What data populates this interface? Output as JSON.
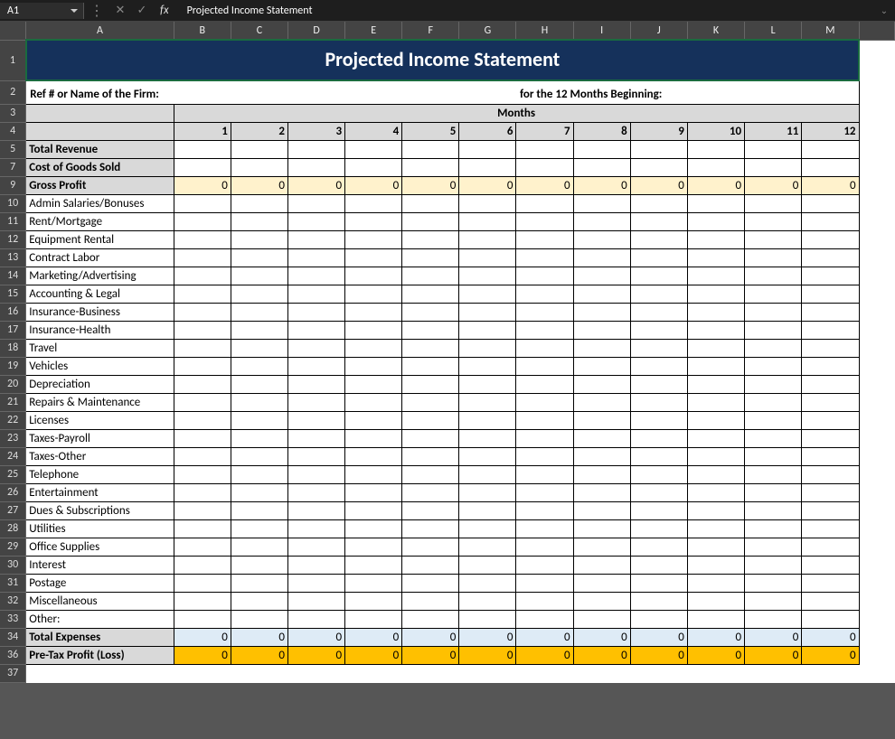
{
  "formulaBar": {
    "cellRef": "A1",
    "formulaValue": "Projected Income Statement"
  },
  "columns": [
    "A",
    "B",
    "C",
    "D",
    "E",
    "F",
    "G",
    "H",
    "I",
    "J",
    "K",
    "L",
    "M"
  ],
  "title": "Projected Income Statement",
  "refLabel": "Ref # or Name of the Firm:",
  "periodLabel": "for the 12 Months Beginning:",
  "monthsHeader": "Months",
  "monthNumbers": [
    "1",
    "2",
    "3",
    "4",
    "5",
    "6",
    "7",
    "8",
    "9",
    "10",
    "11",
    "12"
  ],
  "rows": [
    {
      "num": "5",
      "label": "Total Revenue",
      "style": "bold-label",
      "vals": [
        "",
        "",
        "",
        "",
        "",
        "",
        "",
        "",
        "",
        "",
        "",
        ""
      ]
    },
    {
      "num": "7",
      "label": "Cost of Goods Sold",
      "style": "bold-label",
      "vals": [
        "",
        "",
        "",
        "",
        "",
        "",
        "",
        "",
        "",
        "",
        "",
        ""
      ]
    },
    {
      "num": "9",
      "label": "Gross Profit",
      "style": "calc-gross",
      "vals": [
        "0",
        "0",
        "0",
        "0",
        "0",
        "0",
        "0",
        "0",
        "0",
        "0",
        "0",
        "0"
      ]
    },
    {
      "num": "10",
      "label": "Admin Salaries/Bonuses",
      "style": "plain-label",
      "vals": [
        "",
        "",
        "",
        "",
        "",
        "",
        "",
        "",
        "",
        "",
        "",
        ""
      ]
    },
    {
      "num": "11",
      "label": "Rent/Mortgage",
      "style": "plain-label",
      "vals": [
        "",
        "",
        "",
        "",
        "",
        "",
        "",
        "",
        "",
        "",
        "",
        ""
      ]
    },
    {
      "num": "12",
      "label": "Equipment Rental",
      "style": "plain-label",
      "vals": [
        "",
        "",
        "",
        "",
        "",
        "",
        "",
        "",
        "",
        "",
        "",
        ""
      ]
    },
    {
      "num": "13",
      "label": "Contract Labor",
      "style": "plain-label",
      "vals": [
        "",
        "",
        "",
        "",
        "",
        "",
        "",
        "",
        "",
        "",
        "",
        ""
      ]
    },
    {
      "num": "14",
      "label": "Marketing/Advertising",
      "style": "plain-label",
      "vals": [
        "",
        "",
        "",
        "",
        "",
        "",
        "",
        "",
        "",
        "",
        "",
        ""
      ]
    },
    {
      "num": "15",
      "label": "Accounting & Legal",
      "style": "plain-label",
      "vals": [
        "",
        "",
        "",
        "",
        "",
        "",
        "",
        "",
        "",
        "",
        "",
        ""
      ]
    },
    {
      "num": "16",
      "label": "Insurance-Business",
      "style": "plain-label",
      "vals": [
        "",
        "",
        "",
        "",
        "",
        "",
        "",
        "",
        "",
        "",
        "",
        ""
      ]
    },
    {
      "num": "17",
      "label": "Insurance-Health",
      "style": "plain-label",
      "vals": [
        "",
        "",
        "",
        "",
        "",
        "",
        "",
        "",
        "",
        "",
        "",
        ""
      ]
    },
    {
      "num": "18",
      "label": "Travel",
      "style": "plain-label",
      "vals": [
        "",
        "",
        "",
        "",
        "",
        "",
        "",
        "",
        "",
        "",
        "",
        ""
      ]
    },
    {
      "num": "19",
      "label": "Vehicles",
      "style": "plain-label",
      "vals": [
        "",
        "",
        "",
        "",
        "",
        "",
        "",
        "",
        "",
        "",
        "",
        ""
      ]
    },
    {
      "num": "20",
      "label": "Depreciation",
      "style": "plain-label",
      "vals": [
        "",
        "",
        "",
        "",
        "",
        "",
        "",
        "",
        "",
        "",
        "",
        ""
      ]
    },
    {
      "num": "21",
      "label": "Repairs & Maintenance",
      "style": "plain-label",
      "vals": [
        "",
        "",
        "",
        "",
        "",
        "",
        "",
        "",
        "",
        "",
        "",
        ""
      ]
    },
    {
      "num": "22",
      "label": "Licenses",
      "style": "plain-label",
      "vals": [
        "",
        "",
        "",
        "",
        "",
        "",
        "",
        "",
        "",
        "",
        "",
        ""
      ]
    },
    {
      "num": "23",
      "label": "Taxes-Payroll",
      "style": "plain-label",
      "vals": [
        "",
        "",
        "",
        "",
        "",
        "",
        "",
        "",
        "",
        "",
        "",
        ""
      ]
    },
    {
      "num": "24",
      "label": "Taxes-Other",
      "style": "plain-label",
      "vals": [
        "",
        "",
        "",
        "",
        "",
        "",
        "",
        "",
        "",
        "",
        "",
        ""
      ]
    },
    {
      "num": "25",
      "label": "Telephone",
      "style": "plain-label",
      "vals": [
        "",
        "",
        "",
        "",
        "",
        "",
        "",
        "",
        "",
        "",
        "",
        ""
      ]
    },
    {
      "num": "26",
      "label": "Entertainment",
      "style": "plain-label",
      "vals": [
        "",
        "",
        "",
        "",
        "",
        "",
        "",
        "",
        "",
        "",
        "",
        ""
      ]
    },
    {
      "num": "27",
      "label": "Dues & Subscriptions",
      "style": "plain-label",
      "vals": [
        "",
        "",
        "",
        "",
        "",
        "",
        "",
        "",
        "",
        "",
        "",
        ""
      ]
    },
    {
      "num": "28",
      "label": "Utilities",
      "style": "plain-label",
      "vals": [
        "",
        "",
        "",
        "",
        "",
        "",
        "",
        "",
        "",
        "",
        "",
        ""
      ]
    },
    {
      "num": "29",
      "label": "Office Supplies",
      "style": "plain-label",
      "vals": [
        "",
        "",
        "",
        "",
        "",
        "",
        "",
        "",
        "",
        "",
        "",
        ""
      ]
    },
    {
      "num": "30",
      "label": "Interest",
      "style": "plain-label",
      "vals": [
        "",
        "",
        "",
        "",
        "",
        "",
        "",
        "",
        "",
        "",
        "",
        ""
      ]
    },
    {
      "num": "31",
      "label": "Postage",
      "style": "plain-label",
      "vals": [
        "",
        "",
        "",
        "",
        "",
        "",
        "",
        "",
        "",
        "",
        "",
        ""
      ]
    },
    {
      "num": "32",
      "label": "Miscellaneous",
      "style": "plain-label",
      "vals": [
        "",
        "",
        "",
        "",
        "",
        "",
        "",
        "",
        "",
        "",
        "",
        ""
      ]
    },
    {
      "num": "33",
      "label": "Other:",
      "style": "plain-label",
      "vals": [
        "",
        "",
        "",
        "",
        "",
        "",
        "",
        "",
        "",
        "",
        "",
        ""
      ]
    },
    {
      "num": "34",
      "label": "Total Expenses",
      "style": "calc-total",
      "vals": [
        "0",
        "0",
        "0",
        "0",
        "0",
        "0",
        "0",
        "0",
        "0",
        "0",
        "0",
        "0"
      ]
    },
    {
      "num": "36",
      "label": "Pre-Tax Profit (Loss)",
      "style": "calc-pretax",
      "vals": [
        "0",
        "0",
        "0",
        "0",
        "0",
        "0",
        "0",
        "0",
        "0",
        "0",
        "0",
        "0"
      ]
    },
    {
      "num": "37",
      "label": "",
      "style": "empty",
      "vals": [
        "",
        "",
        "",
        "",
        "",
        "",
        "",
        "",
        "",
        "",
        "",
        ""
      ]
    }
  ]
}
